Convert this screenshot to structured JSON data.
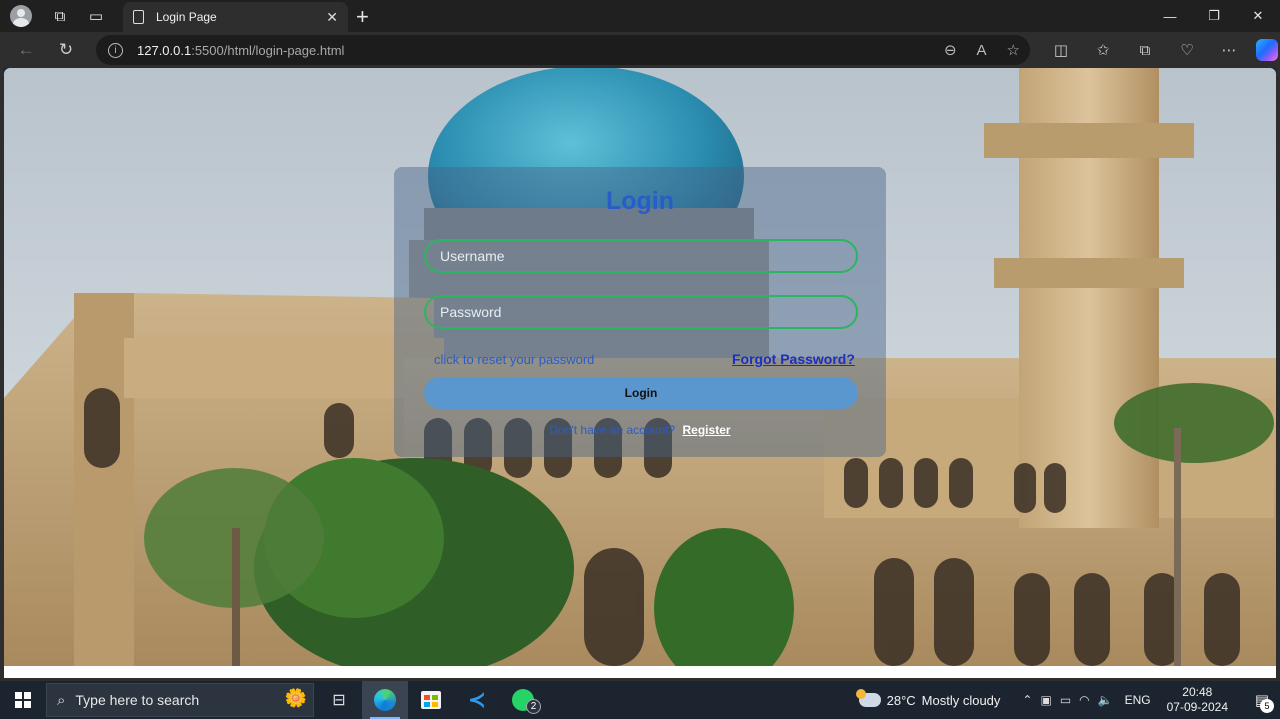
{
  "browser": {
    "tab_title": "Login Page",
    "url_host": "127.0.0.1",
    "url_rest": ":5500/html/login-page.html"
  },
  "login": {
    "title": "Login",
    "username_placeholder": "Username",
    "password_placeholder": "Password",
    "reset_text": "click to reset your password",
    "forgot_link": "Forgot Password?",
    "login_button": "Login",
    "no_account_text": "Don't have an account?",
    "register_link": "Register"
  },
  "taskbar": {
    "search_placeholder": "Type here to search",
    "whatsapp_badge": "2",
    "temperature": "28°C",
    "weather_text": "Mostly cloudy",
    "weather_alert": "1",
    "language": "ENG",
    "time": "20:48",
    "date": "07-09-2024",
    "notification_count": "5"
  },
  "colors": {
    "login_title": "#2a5cc9",
    "field_border": "#2bb560",
    "login_button_bg": "#5b97cf",
    "forgot_link": "#1a2fc4"
  }
}
